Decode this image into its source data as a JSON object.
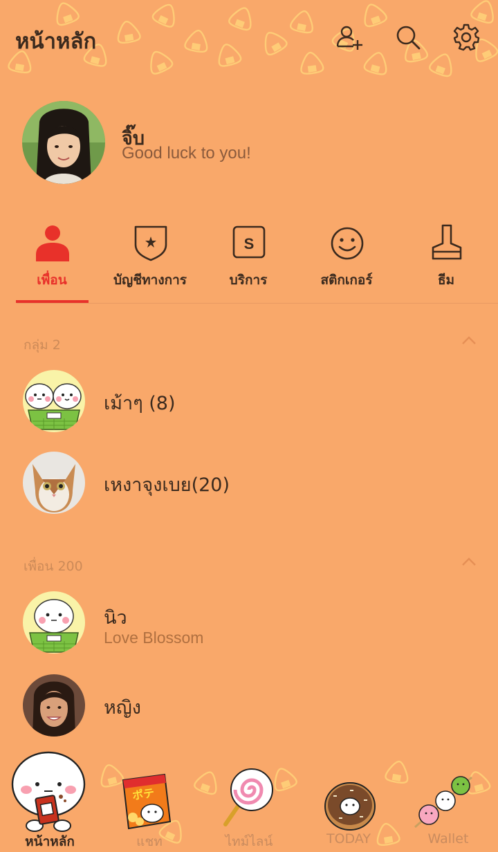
{
  "header": {
    "title": "หน้าหลัก",
    "icons": [
      "add-friend-icon",
      "search-icon",
      "settings-icon"
    ]
  },
  "profile": {
    "name": "จิ๊บ",
    "status": "Good luck to you!"
  },
  "tabs": [
    {
      "label": "เพื่อน",
      "icon": "person-icon",
      "active": true
    },
    {
      "label": "บัญชีทางการ",
      "icon": "shield-star-icon",
      "active": false
    },
    {
      "label": "บริการ",
      "icon": "service-s-icon",
      "active": false
    },
    {
      "label": "สติกเกอร์",
      "icon": "smiley-icon",
      "active": false
    },
    {
      "label": "ธีม",
      "icon": "brush-icon",
      "active": false
    }
  ],
  "groups": {
    "header": "กลุ่ม 2",
    "items": [
      {
        "name": "เม้าๆ (8)"
      },
      {
        "name": "เหงาจุงเบย(20)"
      }
    ]
  },
  "friends": {
    "header": "เพื่อน 200",
    "items": [
      {
        "name": "นิว",
        "status": "Love Blossom"
      },
      {
        "name": "หญิง"
      }
    ]
  },
  "bottom_nav": [
    {
      "label": "หน้าหลัก",
      "active": true
    },
    {
      "label": "แชท",
      "active": false
    },
    {
      "label": "ไทม์ไลน์",
      "active": false
    },
    {
      "label": "TODAY",
      "active": false
    },
    {
      "label": "Wallet",
      "active": false
    }
  ],
  "colors": {
    "background": "#F9A86A",
    "accent": "#E8312A",
    "text": "#3B2A1E"
  }
}
